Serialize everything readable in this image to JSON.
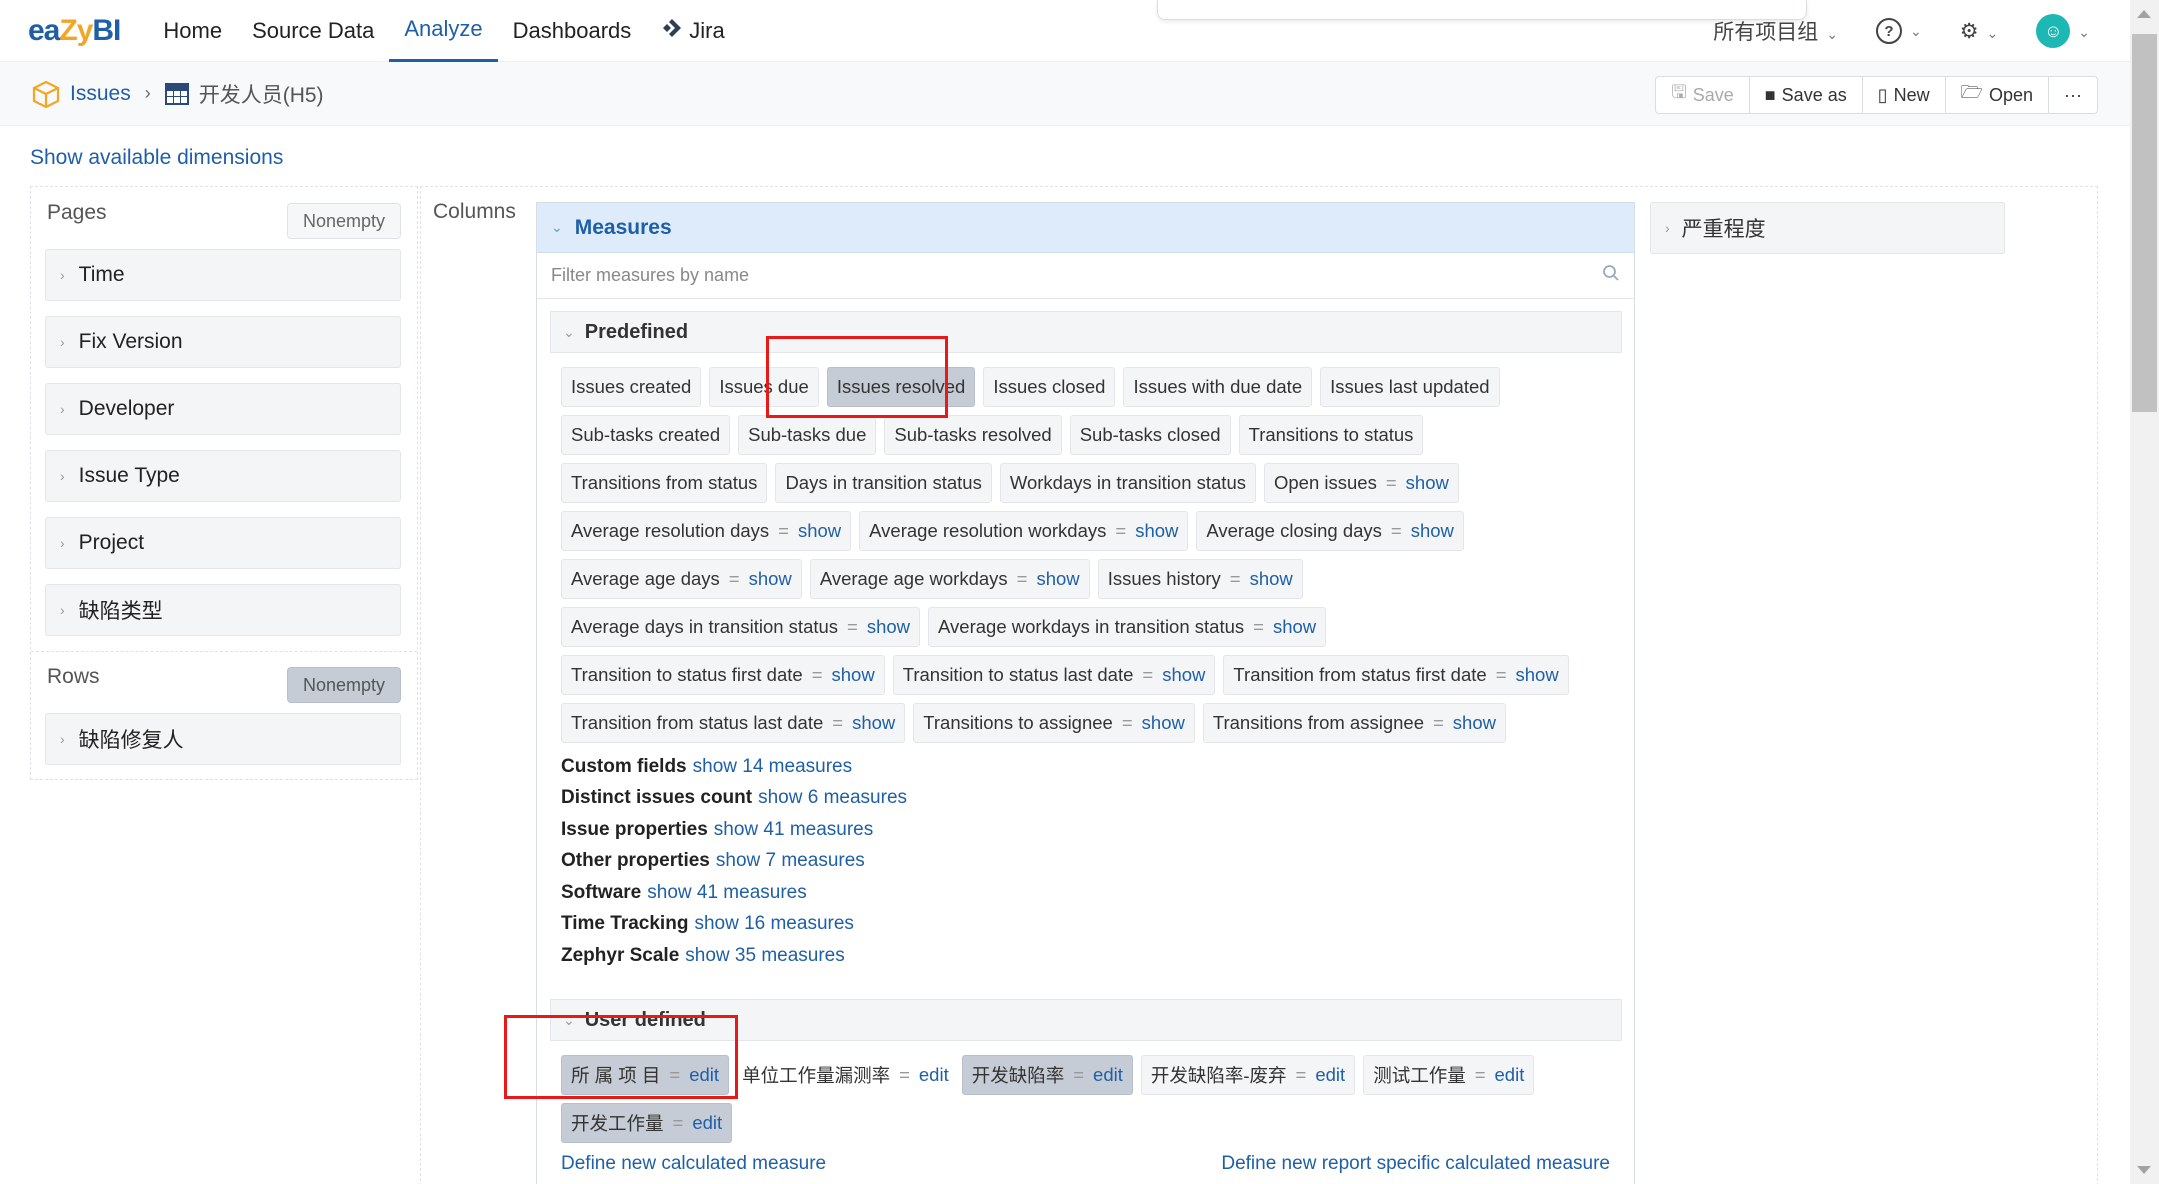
{
  "nav": {
    "logo_e": "ea",
    "logo_z": "Zy",
    "logo_bi": "BI",
    "items": [
      "Home",
      "Source Data",
      "Analyze",
      "Dashboards",
      "Jira"
    ],
    "active": "Analyze",
    "project_group": "所有项目组"
  },
  "breadcrumb": {
    "issues": "Issues",
    "report": "开发人员(H5)"
  },
  "toolbar": {
    "save": "Save",
    "save_as": "Save as",
    "new": "New",
    "open": "Open",
    "more": "···"
  },
  "show_dims": "Show available dimensions",
  "pages": {
    "title": "Pages",
    "nonempty": "Nonempty",
    "items": [
      "Time",
      "Fix Version",
      "Developer",
      "Issue Type",
      "Project",
      "缺陷类型"
    ]
  },
  "rows": {
    "title": "Rows",
    "nonempty": "Nonempty",
    "items": [
      "缺陷修复人"
    ]
  },
  "columns_label": "Columns",
  "measures": {
    "title": "Measures",
    "filter_placeholder": "Filter measures by name",
    "predefined_title": "Predefined",
    "predefined": [
      {
        "label": "Issues created",
        "link": ""
      },
      {
        "label": "Issues due",
        "link": ""
      },
      {
        "label": "Issues resolved",
        "link": "",
        "selected": true
      },
      {
        "label": "Issues closed",
        "link": ""
      },
      {
        "label": "Issues with due date",
        "link": ""
      },
      {
        "label": "Issues last updated",
        "link": ""
      },
      {
        "label": "Sub-tasks created",
        "link": ""
      },
      {
        "label": "Sub-tasks due",
        "link": ""
      },
      {
        "label": "Sub-tasks resolved",
        "link": ""
      },
      {
        "label": "Sub-tasks closed",
        "link": ""
      },
      {
        "label": "Transitions to status",
        "link": ""
      },
      {
        "label": "Transitions from status",
        "link": ""
      },
      {
        "label": "Days in transition status",
        "link": ""
      },
      {
        "label": "Workdays in transition status",
        "link": ""
      },
      {
        "label": "Open issues",
        "link": "show"
      },
      {
        "label": "Average resolution days",
        "link": "show"
      },
      {
        "label": "Average resolution workdays",
        "link": "show"
      },
      {
        "label": "Average closing days",
        "link": "show"
      },
      {
        "label": "Average age days",
        "link": "show"
      },
      {
        "label": "Average age workdays",
        "link": "show"
      },
      {
        "label": "Issues history",
        "link": "show"
      },
      {
        "label": "Average days in transition status",
        "link": "show"
      },
      {
        "label": "Average workdays in transition status",
        "link": "show"
      },
      {
        "label": "Transition to status first date",
        "link": "show"
      },
      {
        "label": "Transition to status last date",
        "link": "show"
      },
      {
        "label": "Transition from status first date",
        "link": "show"
      },
      {
        "label": "Transition from status last date",
        "link": "show"
      },
      {
        "label": "Transitions to assignee",
        "link": "show"
      },
      {
        "label": "Transitions from assignee",
        "link": "show"
      }
    ],
    "groups": [
      {
        "name": "Custom fields",
        "link": "show 14 measures"
      },
      {
        "name": "Distinct issues count",
        "link": "show 6 measures"
      },
      {
        "name": "Issue properties",
        "link": "show 41 measures"
      },
      {
        "name": "Other properties",
        "link": "show 7 measures"
      },
      {
        "name": "Software",
        "link": "show 41 measures"
      },
      {
        "name": "Time Tracking",
        "link": "show 16 measures"
      },
      {
        "name": "Zephyr Scale",
        "link": "show 35 measures"
      }
    ],
    "user_defined_title": "User defined",
    "user_defined": [
      {
        "label": "所 属 项 目",
        "link": "edit",
        "selected": true
      },
      {
        "label": "单位工作量漏测率",
        "link": "edit",
        "plain": true
      },
      {
        "label": "开发缺陷率",
        "link": "edit",
        "selected": true
      },
      {
        "label": "开发缺陷率-废弃",
        "link": "edit"
      },
      {
        "label": "测试工作量",
        "link": "edit"
      },
      {
        "label": "开发工作量",
        "link": "edit",
        "selected": true
      }
    ],
    "define_new": "Define new calculated measure",
    "define_report": "Define new report specific calculated measure"
  },
  "severity": "严重程度"
}
